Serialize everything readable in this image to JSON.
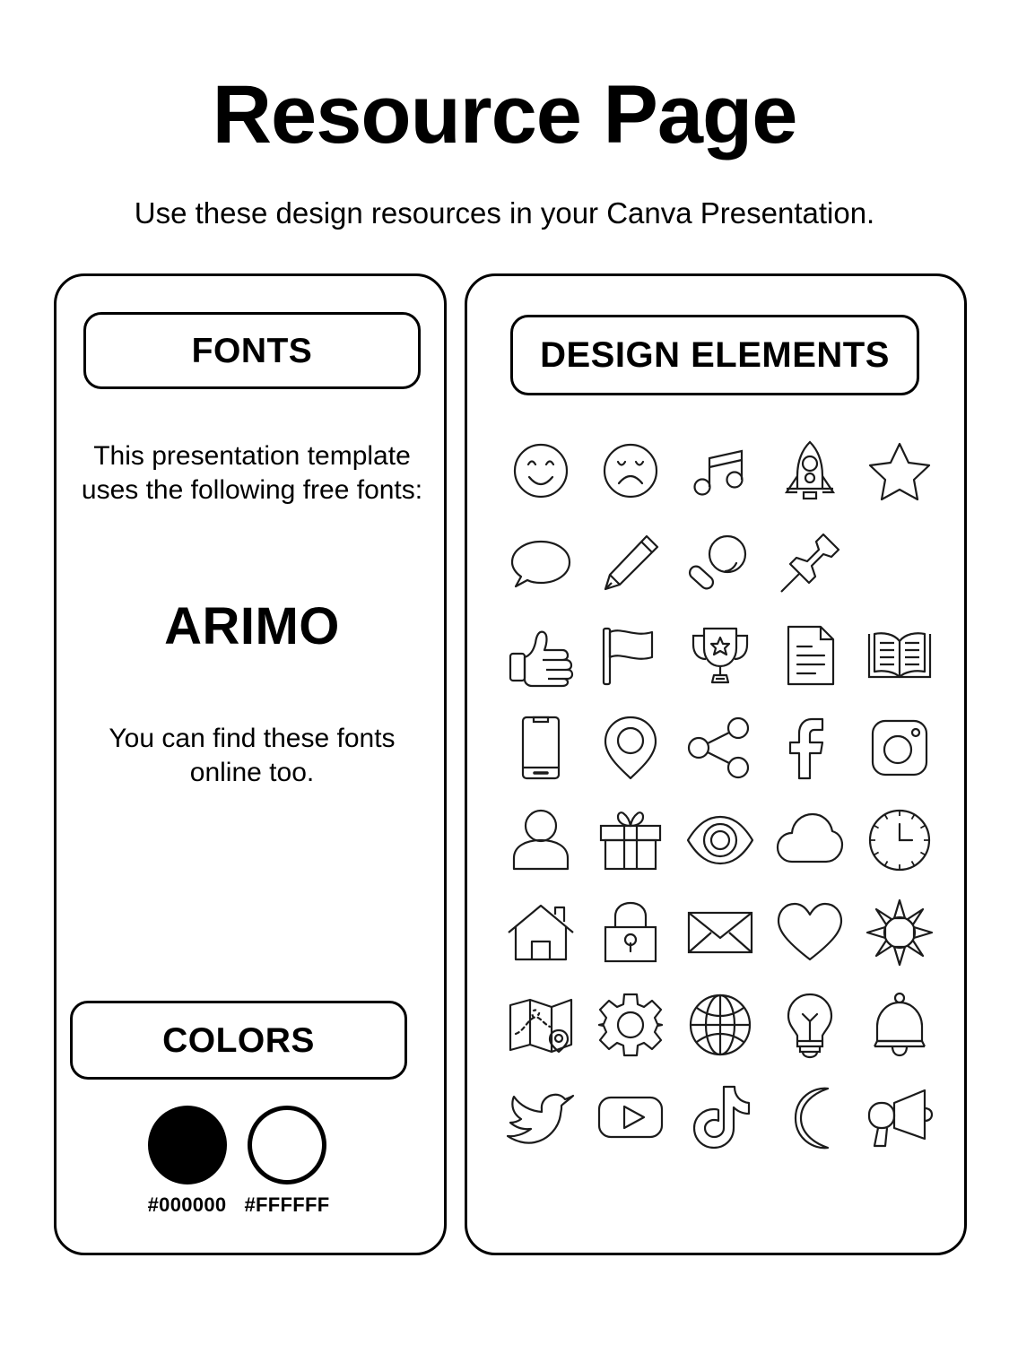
{
  "header": {
    "title": "Resource Page",
    "subtitle": "Use these design resources in your Canva Presentation."
  },
  "fonts_card": {
    "heading": "FONTS",
    "intro": "This presentation template uses the following free fonts:",
    "font_name": "ARIMO",
    "outro": "You can find these fonts online too."
  },
  "colors_card": {
    "heading": "COLORS",
    "swatches": [
      {
        "hex": "#000000",
        "label": "#000000",
        "style": "filled"
      },
      {
        "hex": "#FFFFFF",
        "label": "#FFFFFF",
        "style": "outline"
      }
    ]
  },
  "design_card": {
    "heading": "DESIGN ELEMENTS",
    "rows": [
      [
        "smiley-face-icon",
        "sad-face-icon",
        "music-note-icon",
        "rocket-icon",
        "star-icon"
      ],
      [
        "speech-bubble-icon",
        "pencil-icon",
        "magnifying-glass-icon",
        "push-pin-icon",
        "empty"
      ],
      [
        "thumbs-up-icon",
        "flag-icon",
        "trophy-icon",
        "document-icon",
        "open-book-icon"
      ],
      [
        "smartphone-icon",
        "location-pin-icon",
        "share-icon",
        "facebook-icon",
        "instagram-icon"
      ],
      [
        "user-icon",
        "gift-icon",
        "eye-icon",
        "cloud-icon",
        "clock-icon"
      ],
      [
        "house-icon",
        "lock-icon",
        "envelope-icon",
        "heart-icon",
        "sun-icon"
      ],
      [
        "map-icon",
        "gear-icon",
        "globe-icon",
        "lightbulb-icon",
        "bell-icon"
      ],
      [
        "twitter-icon",
        "youtube-icon",
        "tiktok-icon",
        "moon-icon",
        "megaphone-icon"
      ]
    ]
  },
  "theme": {
    "stroke": "#1b1b1b",
    "border": "#000000",
    "background": "#FFFFFF"
  }
}
